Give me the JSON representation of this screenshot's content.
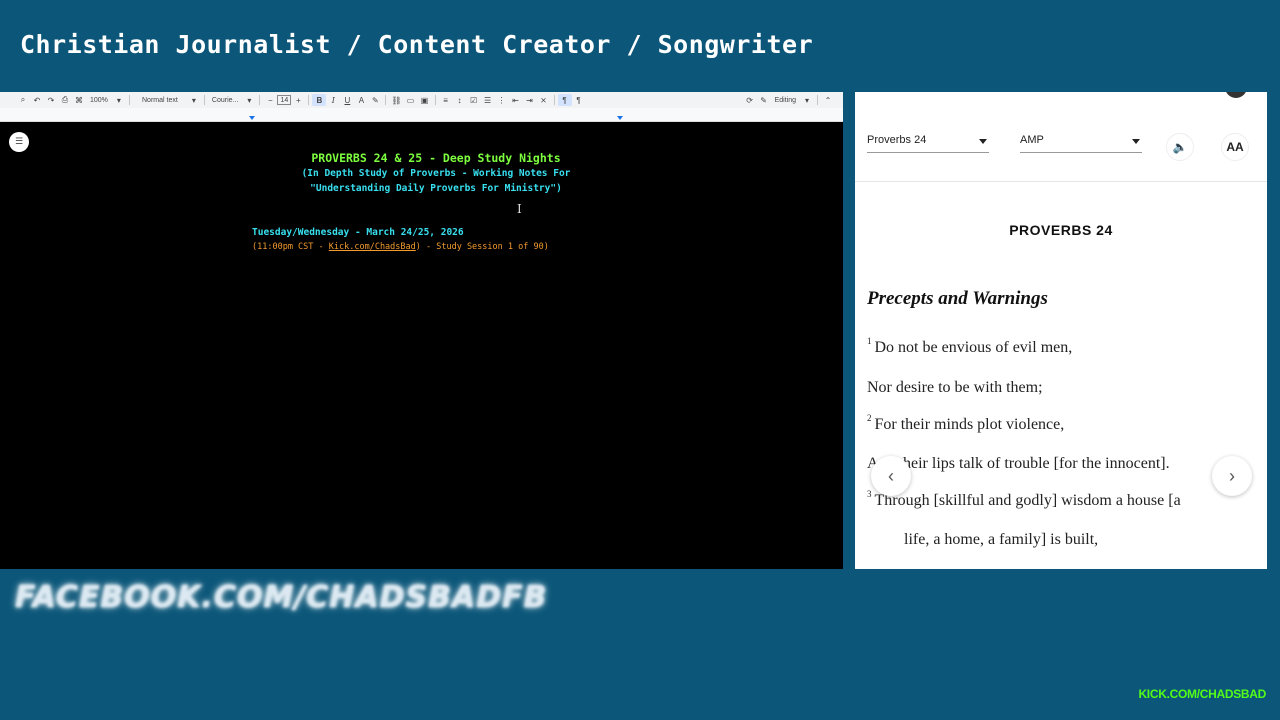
{
  "overlay": {
    "header_title": "Christian Journalist / Content Creator / Songwriter",
    "facebook": "FACEBOOK.COM/CHADSBADFB",
    "kick": "KICK.COM/CHADSBAD"
  },
  "docs": {
    "toolbar": {
      "zoom": "100%",
      "style": "Normal text",
      "font": "Courie...",
      "font_size": "14",
      "mode": "Editing",
      "minus": "−",
      "plus": "+",
      "bold": "B",
      "italic": "I",
      "underline": "U",
      "text_color": "A"
    },
    "title": "PROVERBS 24 & 25 - Deep Study Nights",
    "subtitle_1": "(In Depth Study of Proverbs - Working Notes For",
    "subtitle_2": "\"Understanding Daily Proverbs For Ministry\")",
    "date_line": "Tuesday/Wednesday - March 24/25, 2026",
    "time_prefix": "(11:00pm CST - ",
    "time_link": "Kick.com/ChadsBad",
    "time_suffix": ") - Study Session 1 of 90)"
  },
  "bible": {
    "book_select": "Proverbs 24",
    "version_select": "AMP",
    "font_button": "AA",
    "chapter_heading": "PROVERBS 24",
    "section_heading": "Precepts and Warnings",
    "verses": [
      {
        "num": "1",
        "text": "Do not be envious of evil men,"
      },
      {
        "num": "",
        "text": "Nor desire to be with them;"
      },
      {
        "num": "2",
        "text": "For their minds plot violence,"
      },
      {
        "num": "",
        "text": "And their lips talk of trouble [for the innocent]."
      },
      {
        "num": "3",
        "text": "Through [skillful and godly] wisdom a house [a"
      },
      {
        "num": "",
        "text": "life, a home, a family] is built,"
      }
    ]
  },
  "colors": {
    "background": "#0b5679",
    "doc_title": "#7dff3f",
    "doc_subtitle": "#38e0ef",
    "doc_time": "#f29a2e",
    "kick_green": "#53fc18"
  },
  "icons": [
    "search-icon",
    "undo-icon",
    "redo-icon",
    "print-icon",
    "paint-format-icon",
    "link-icon",
    "comment-icon",
    "image-icon",
    "align-icon",
    "line-spacing-icon",
    "checklist-icon",
    "bullet-list-icon",
    "numbered-list-icon",
    "indent-icon",
    "clear-format-icon",
    "pencil-icon",
    "chevron-up-icon",
    "outline-icon",
    "speaker-icon",
    "chevron-left-icon",
    "chevron-right-icon"
  ]
}
